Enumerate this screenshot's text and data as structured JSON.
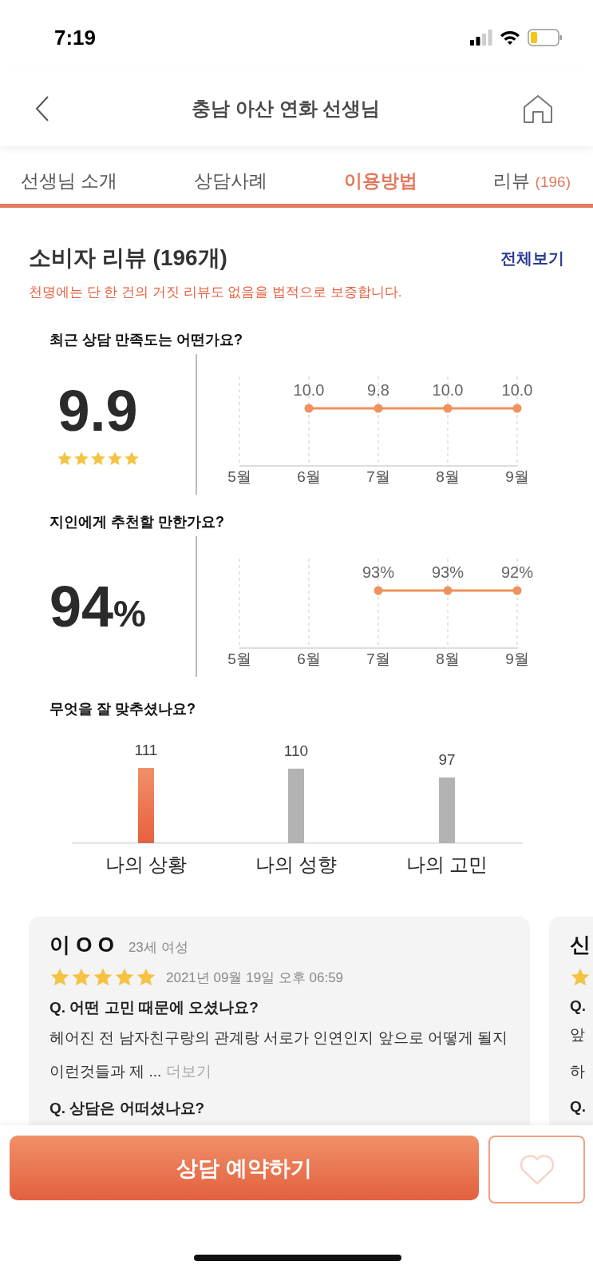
{
  "status_bar": {
    "time": "7:19"
  },
  "header": {
    "title": "충남 아산 연화 선생님"
  },
  "tabs": [
    {
      "label": "선생님 소개",
      "selected": false
    },
    {
      "label": "상담사례",
      "selected": false
    },
    {
      "label": "이용방법",
      "selected": true
    },
    {
      "label": "리뷰",
      "count": "(196)",
      "selected": false
    }
  ],
  "reviews_section": {
    "title": "소비자 리뷰 (196개)",
    "view_all": "전체보기",
    "notice": "천명에는 단 한 건의 거짓 리뷰도 없음을 법적으로 보증합니다."
  },
  "ratings": [
    {
      "question": "최근 상담 만족도는 어떤가요?",
      "score": "9.9",
      "stars": 5,
      "trend": [
        {
          "month": "5월"
        },
        {
          "month": "6월",
          "value": "10.0"
        },
        {
          "month": "7월",
          "value": "9.8"
        },
        {
          "month": "8월",
          "value": "10.0"
        },
        {
          "month": "9월",
          "value": "10.0"
        }
      ]
    },
    {
      "question": "지인에게 추천할 만한가요?",
      "score": "94",
      "unit": "%",
      "trend": [
        {
          "month": "5월"
        },
        {
          "month": "6월"
        },
        {
          "month": "7월",
          "value": "93%"
        },
        {
          "month": "8월",
          "value": "93%"
        },
        {
          "month": "9월",
          "value": "92%"
        }
      ]
    }
  ],
  "fit": {
    "question": "무엇을 잘 맞추셨나요?",
    "chart_data": {
      "type": "bar",
      "categories": [
        "나의 상황",
        "나의 성향",
        "나의 고민"
      ],
      "series": [
        {
          "colors": [
            "#e8603f",
            "#b3b3b3",
            "#b3b3b3"
          ],
          "values": [
            111,
            110,
            97
          ]
        }
      ],
      "data_labels": true
    }
  },
  "review_cards": [
    {
      "kind": "full",
      "name": "이 O O",
      "meta": "23세 여성",
      "stars": 5,
      "date": "2021년 09월 19일 오후 06:59",
      "lines": [
        {
          "kind": "question",
          "text": "Q. 어떤 고민 때문에 오셨나요?"
        },
        {
          "kind": "answer",
          "text": "헤어진 전 남자친구랑의 관계랑 서로가 인연인지 앞으로 어떻게 될지 이런것들과 제 ...",
          "more": "더보기"
        },
        {
          "kind": "question",
          "text": "Q. 상담은 어떠셨나요?"
        }
      ]
    },
    {
      "kind": "peek",
      "name": "신",
      "lines": [
        {
          "kind": "question",
          "text": "Q."
        },
        {
          "kind": "answer",
          "text": "앞"
        },
        {
          "kind": "answer",
          "text": "하"
        },
        {
          "kind": "question",
          "text": "Q."
        }
      ]
    }
  ],
  "action_bar": {
    "reserve_button": "상담 예약하기"
  }
}
